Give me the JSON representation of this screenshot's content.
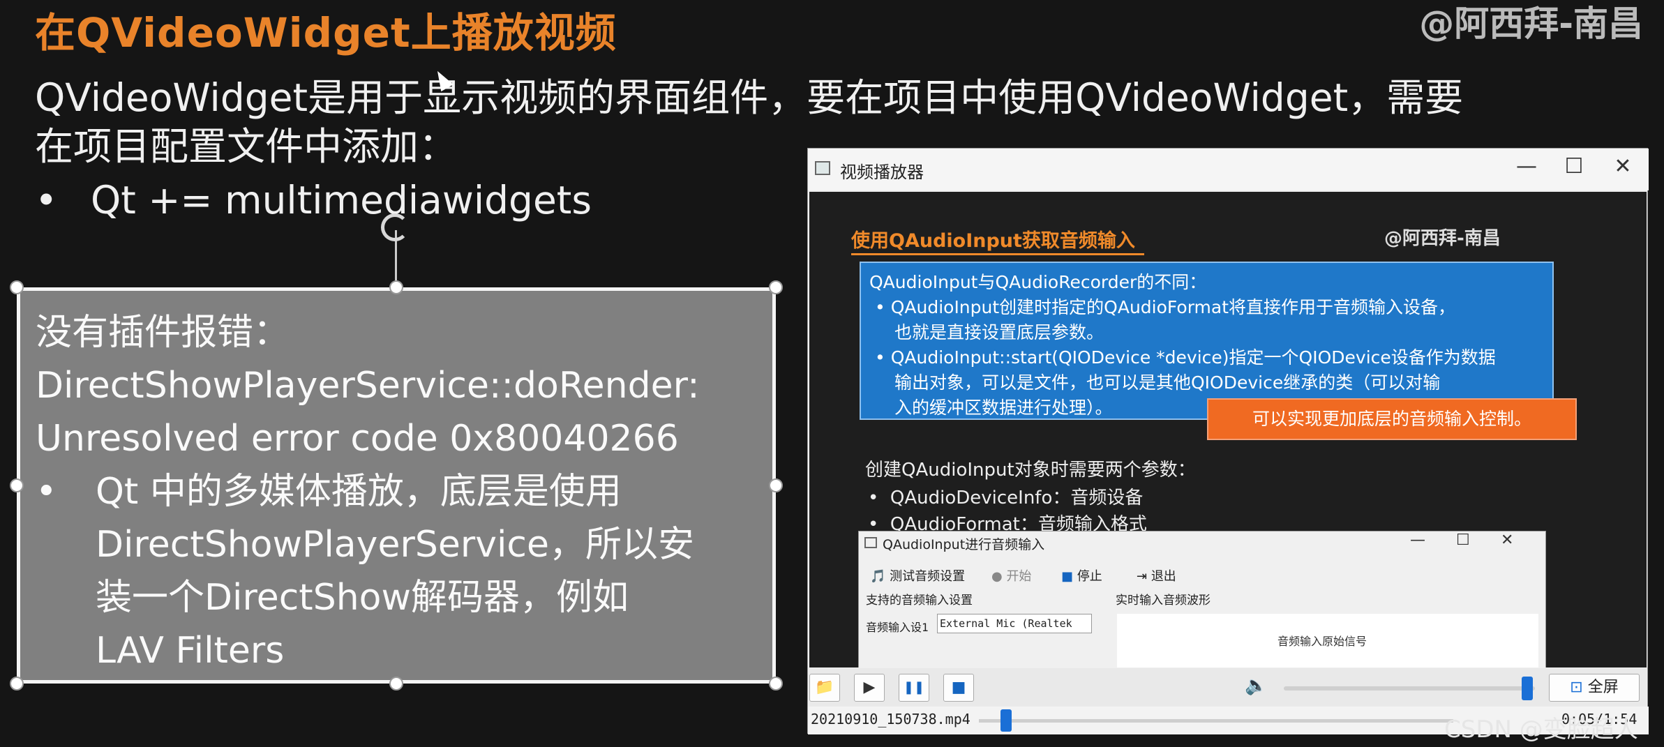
{
  "slide": {
    "title": "在QVideoWidget上播放视频",
    "watermark_top": "@阿西拜-南昌",
    "intro_line1": "QVideoWidget是用于显示视频的界面组件，要在项目中使用QVideoWidget，需要",
    "intro_line2": "在项目配置文件中添加：",
    "bullet1": "Qt += multimediawidgets",
    "bullet_mark": "•"
  },
  "error_box": {
    "line1": "没有插件报错：",
    "line2": "DirectShowPlayerService::doRender:",
    "line3": "Unresolved error code 0x80040266",
    "bullet_line1": "Qt 中的多媒体播放，底层是使用",
    "bullet_line2": "DirectShowPlayerService，所以安",
    "bullet_line3": "装一个DirectShow解码器，例如",
    "bullet_line4": "LAV Filters"
  },
  "player": {
    "title": "视频播放器",
    "minimize": "—",
    "maximize": "☐",
    "close": "✕",
    "video": {
      "heading": "使用QAudioInput获取音频输入",
      "watermark": "@阿西拜-南昌",
      "blue_title": "QAudioInput与QAudioRecorder的不同：",
      "blue_b1_l1": "QAudioInput创建时指定的QAudioFormat将直接作用于音频输入设备，",
      "blue_b1_l2": "也就是直接设置底层参数。",
      "blue_b2_l1": "QAudioInput::start(QIODevice *device)指定一个QIODevice设备作为数据",
      "blue_b2_l2": "输出对象，可以是文件，也可以是其他QIODevice继承的类（可以对输",
      "blue_b2_l3": "入的缓冲区数据进行处理）。",
      "orange_note": "可以实现更加底层的音频输入控制。",
      "params_title": "创建QAudioInput对象时需要两个参数：",
      "param1": "QAudioDeviceInfo：音频设备",
      "param2": "QAudioFormat：音频输入格式",
      "sub_window": {
        "title": "QAudioInput进行音频输入",
        "tb_test": "测试音频设置",
        "tb_start": "开始",
        "tb_stop": "停止",
        "tb_exit": "退出",
        "group_left": "支持的音频输入设置",
        "group_right": "实时输入音频波形",
        "device_label": "音频输入设1",
        "device_value": "External Mic (Realtek",
        "wave_label": "音频输入原始信号"
      }
    },
    "controls": {
      "open_icon": "📁",
      "play_icon": "▶",
      "pause_icon": "❚❚",
      "stop_icon": "■",
      "volume_icon": "🔈",
      "fullscreen": "全屏",
      "volume_level": 0.97
    },
    "status": {
      "filename": "20210910_150738.mp4",
      "time": "0:05/1:54",
      "progress": 0.045
    }
  },
  "footer": {
    "csdn": "CSDN @变脸超人"
  }
}
